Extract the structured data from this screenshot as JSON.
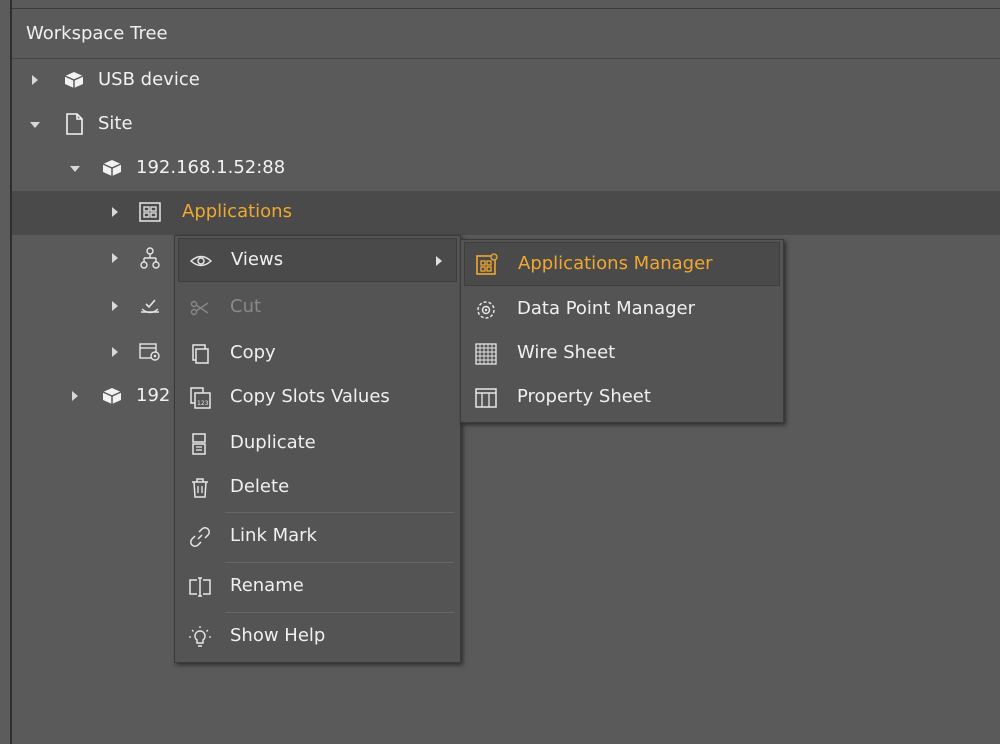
{
  "panel": {
    "title": "Workspace Tree"
  },
  "tree": {
    "usb_device": "USB device",
    "site": "Site",
    "host1": "192.168.1.52:88",
    "applications": "Applications",
    "host2_partial": "192"
  },
  "context_menu": {
    "views": "Views",
    "cut": "Cut",
    "copy": "Copy",
    "copy_slots_values": "Copy Slots Values",
    "duplicate": "Duplicate",
    "delete": "Delete",
    "link_mark": "Link Mark",
    "rename": "Rename",
    "show_help": "Show Help"
  },
  "views_submenu": {
    "applications_manager": "Applications Manager",
    "data_point_manager": "Data Point Manager",
    "wire_sheet": "Wire Sheet",
    "property_sheet": "Property Sheet"
  },
  "colors": {
    "accent": "#f0a830",
    "background": "#5a5a5a",
    "menu_bg": "#545454",
    "highlight": "#4a4a4a"
  }
}
